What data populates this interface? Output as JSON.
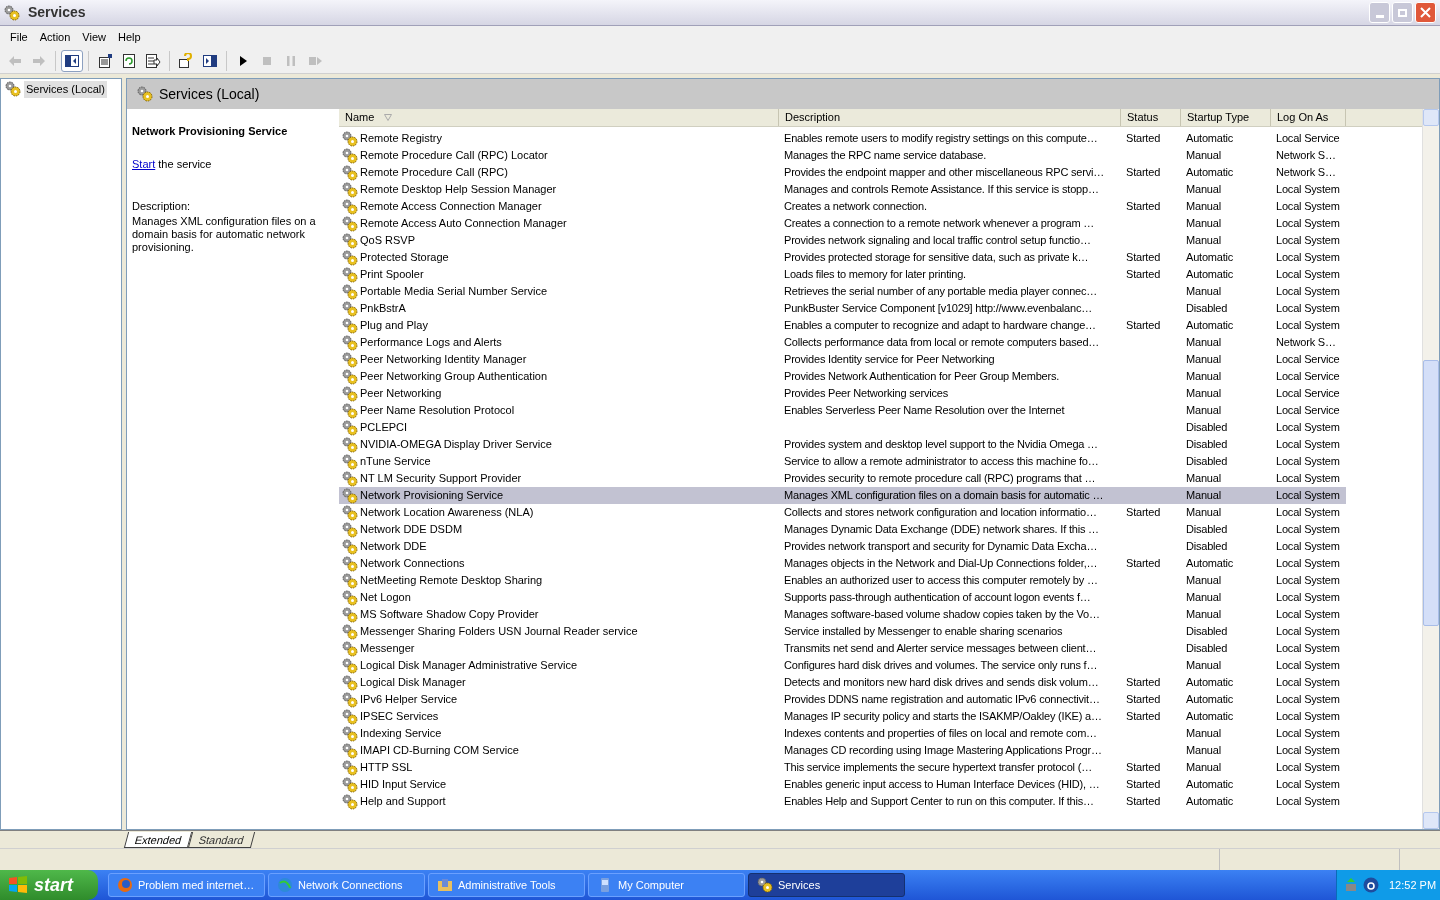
{
  "window": {
    "title": "Services"
  },
  "menu": [
    "File",
    "Action",
    "View",
    "Help"
  ],
  "toolbar": [
    {
      "kind": "back",
      "disabled": true
    },
    {
      "kind": "forward",
      "disabled": true
    },
    {
      "kind": "sep"
    },
    {
      "kind": "tree",
      "selected": true
    },
    {
      "kind": "sep"
    },
    {
      "kind": "properties"
    },
    {
      "kind": "refresh"
    },
    {
      "kind": "export"
    },
    {
      "kind": "sep"
    },
    {
      "kind": "help"
    },
    {
      "kind": "pane"
    },
    {
      "kind": "sep"
    },
    {
      "kind": "play"
    },
    {
      "kind": "stop",
      "disabled": true
    },
    {
      "kind": "pause",
      "disabled": true
    },
    {
      "kind": "restart",
      "disabled": true
    }
  ],
  "tree": {
    "items": [
      {
        "label": "Services (Local)",
        "selected": true
      }
    ]
  },
  "header": {
    "title": "Services (Local)"
  },
  "details": {
    "title": "Network Provisioning Service",
    "action_link": "Start",
    "action_text": " the service",
    "description_label": "Description:",
    "description": "Manages XML configuration files on a domain basis for automatic network provisioning."
  },
  "table": {
    "columns": [
      {
        "label": "Name",
        "sorted": true
      },
      {
        "label": "Description"
      },
      {
        "label": "Status"
      },
      {
        "label": "Startup Type"
      },
      {
        "label": "Log On As"
      }
    ],
    "rows": [
      {
        "name": "Remote Registry",
        "description": "Enables remote users to modify registry settings on this compute…",
        "status": "Started",
        "startup_type": "Automatic",
        "log_on_as": "Local Service",
        "selected": false
      },
      {
        "name": "Remote Procedure Call (RPC) Locator",
        "description": "Manages the RPC name service database.",
        "startup_type": "Manual",
        "log_on_as": "Network S…",
        "selected": false
      },
      {
        "name": "Remote Procedure Call (RPC)",
        "description": "Provides the endpoint mapper and other miscellaneous RPC servi…",
        "status": "Started",
        "startup_type": "Automatic",
        "log_on_as": "Network S…",
        "selected": false
      },
      {
        "name": "Remote Desktop Help Session Manager",
        "description": "Manages and controls Remote Assistance. If this service is stopp…",
        "startup_type": "Manual",
        "log_on_as": "Local System",
        "selected": false
      },
      {
        "name": "Remote Access Connection Manager",
        "description": "Creates a network connection.",
        "status": "Started",
        "startup_type": "Manual",
        "log_on_as": "Local System",
        "selected": false
      },
      {
        "name": "Remote Access Auto Connection Manager",
        "description": "Creates a connection to a remote network whenever a program …",
        "startup_type": "Manual",
        "log_on_as": "Local System",
        "selected": false
      },
      {
        "name": "QoS RSVP",
        "description": "Provides network signaling and local traffic control setup functio…",
        "startup_type": "Manual",
        "log_on_as": "Local System",
        "selected": false
      },
      {
        "name": "Protected Storage",
        "description": "Provides protected storage for sensitive data, such as private k…",
        "status": "Started",
        "startup_type": "Automatic",
        "log_on_as": "Local System",
        "selected": false
      },
      {
        "name": "Print Spooler",
        "description": "Loads files to memory for later printing.",
        "status": "Started",
        "startup_type": "Automatic",
        "log_on_as": "Local System",
        "selected": false
      },
      {
        "name": "Portable Media Serial Number Service",
        "description": "Retrieves the serial number of any portable media player connec…",
        "startup_type": "Manual",
        "log_on_as": "Local System",
        "selected": false
      },
      {
        "name": "PnkBstrA",
        "description": "PunkBuster Service Component [v1029] http://www.evenbalanc…",
        "startup_type": "Disabled",
        "log_on_as": "Local System",
        "selected": false
      },
      {
        "name": "Plug and Play",
        "description": "Enables a computer to recognize and adapt to hardware change…",
        "status": "Started",
        "startup_type": "Automatic",
        "log_on_as": "Local System",
        "selected": false
      },
      {
        "name": "Performance Logs and Alerts",
        "description": "Collects performance data from local or remote computers based…",
        "startup_type": "Manual",
        "log_on_as": "Network S…",
        "selected": false
      },
      {
        "name": "Peer Networking Identity Manager",
        "description": "Provides Identity service for Peer Networking",
        "startup_type": "Manual",
        "log_on_as": "Local Service",
        "selected": false
      },
      {
        "name": "Peer Networking Group Authentication",
        "description": "Provides Network Authentication for Peer Group Members.",
        "startup_type": "Manual",
        "log_on_as": "Local Service",
        "selected": false
      },
      {
        "name": "Peer Networking",
        "description": "Provides Peer Networking services",
        "startup_type": "Manual",
        "log_on_as": "Local Service",
        "selected": false
      },
      {
        "name": "Peer Name Resolution Protocol",
        "description": "Enables Serverless Peer Name Resolution over the Internet",
        "startup_type": "Manual",
        "log_on_as": "Local Service",
        "selected": false
      },
      {
        "name": "PCLEPCI",
        "startup_type": "Disabled",
        "log_on_as": "Local System",
        "selected": false
      },
      {
        "name": "NVIDIA-OMEGA Display Driver Service",
        "description": "Provides system and desktop level support to the Nvidia Omega …",
        "startup_type": "Disabled",
        "log_on_as": "Local System",
        "selected": false
      },
      {
        "name": "nTune Service",
        "description": "Service to allow a remote administrator to access this machine fo…",
        "startup_type": "Disabled",
        "log_on_as": "Local System",
        "selected": false
      },
      {
        "name": "NT LM Security Support Provider",
        "description": "Provides security to remote procedure call (RPC) programs that …",
        "startup_type": "Manual",
        "log_on_as": "Local System",
        "selected": false
      },
      {
        "name": "Network Provisioning Service",
        "description": "Manages XML configuration files on a domain basis for automatic …",
        "startup_type": "Manual",
        "log_on_as": "Local System",
        "selected": true
      },
      {
        "name": "Network Location Awareness (NLA)",
        "description": "Collects and stores network configuration and location informatio…",
        "status": "Started",
        "startup_type": "Manual",
        "log_on_as": "Local System",
        "selected": false
      },
      {
        "name": "Network DDE DSDM",
        "description": "Manages Dynamic Data Exchange (DDE) network shares. If this …",
        "startup_type": "Disabled",
        "log_on_as": "Local System",
        "selected": false
      },
      {
        "name": "Network DDE",
        "description": "Provides network transport and security for Dynamic Data Excha…",
        "startup_type": "Disabled",
        "log_on_as": "Local System",
        "selected": false
      },
      {
        "name": "Network Connections",
        "description": "Manages objects in the Network and Dial-Up Connections folder,…",
        "status": "Started",
        "startup_type": "Automatic",
        "log_on_as": "Local System",
        "selected": false
      },
      {
        "name": "NetMeeting Remote Desktop Sharing",
        "description": "Enables an authorized user to access this computer remotely by …",
        "startup_type": "Manual",
        "log_on_as": "Local System",
        "selected": false
      },
      {
        "name": "Net Logon",
        "description": "Supports pass-through authentication of account logon events f…",
        "startup_type": "Manual",
        "log_on_as": "Local System",
        "selected": false
      },
      {
        "name": "MS Software Shadow Copy Provider",
        "description": "Manages software-based volume shadow copies taken by the Vo…",
        "startup_type": "Manual",
        "log_on_as": "Local System",
        "selected": false
      },
      {
        "name": "Messenger Sharing Folders USN Journal Reader service",
        "description": "Service installed by Messenger to enable sharing scenarios",
        "startup_type": "Disabled",
        "log_on_as": "Local System",
        "selected": false
      },
      {
        "name": "Messenger",
        "description": "Transmits net send and Alerter service messages between client…",
        "startup_type": "Disabled",
        "log_on_as": "Local System",
        "selected": false
      },
      {
        "name": "Logical Disk Manager Administrative Service",
        "description": "Configures hard disk drives and volumes. The service only runs f…",
        "startup_type": "Manual",
        "log_on_as": "Local System",
        "selected": false
      },
      {
        "name": "Logical Disk Manager",
        "description": "Detects and monitors new hard disk drives and sends disk volum…",
        "status": "Started",
        "startup_type": "Automatic",
        "log_on_as": "Local System",
        "selected": false
      },
      {
        "name": "IPv6 Helper Service",
        "description": "Provides DDNS name registration and automatic IPv6 connectivit…",
        "status": "Started",
        "startup_type": "Automatic",
        "log_on_as": "Local System",
        "selected": false
      },
      {
        "name": "IPSEC Services",
        "description": "Manages IP security policy and starts the ISAKMP/Oakley (IKE) a…",
        "status": "Started",
        "startup_type": "Automatic",
        "log_on_as": "Local System",
        "selected": false
      },
      {
        "name": "Indexing Service",
        "description": "Indexes contents and properties of files on local and remote com…",
        "startup_type": "Manual",
        "log_on_as": "Local System",
        "selected": false
      },
      {
        "name": "IMAPI CD-Burning COM Service",
        "description": "Manages CD recording using Image Mastering Applications Progr…",
        "startup_type": "Manual",
        "log_on_as": "Local System",
        "selected": false
      },
      {
        "name": "HTTP SSL",
        "description": "This service implements the secure hypertext transfer protocol (…",
        "status": "Started",
        "startup_type": "Manual",
        "log_on_as": "Local System",
        "selected": false
      },
      {
        "name": "HID Input Service",
        "description": "Enables generic input access to Human Interface Devices (HID), …",
        "status": "Started",
        "startup_type": "Automatic",
        "log_on_as": "Local System",
        "selected": false
      },
      {
        "name": "Help and Support",
        "description": "Enables Help and Support Center to run on this computer. If this…",
        "status": "Started",
        "startup_type": "Automatic",
        "log_on_as": "Local System",
        "selected": false
      }
    ]
  },
  "view_tabs": [
    {
      "label": "Extended",
      "selected": true
    },
    {
      "label": "Standard",
      "selected": false
    }
  ],
  "taskbar": {
    "start": "start",
    "items": [
      {
        "kind": "browser",
        "label": "Problem med internet…",
        "selected": false
      },
      {
        "kind": "network",
        "label": "Network Connections",
        "selected": false
      },
      {
        "kind": "tools",
        "label": "Administrative Tools",
        "selected": false
      },
      {
        "kind": "computer",
        "label": "My Computer",
        "selected": false
      },
      {
        "kind": "gear",
        "label": "Services",
        "selected": true
      }
    ],
    "clock": "12:52 PM"
  }
}
